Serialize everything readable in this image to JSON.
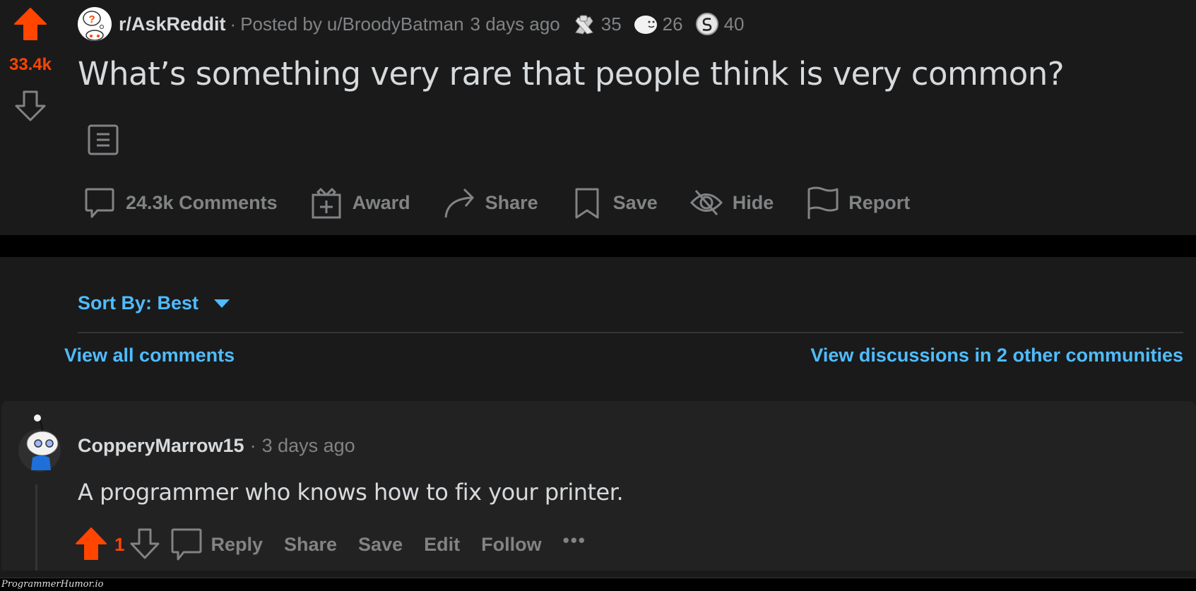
{
  "post": {
    "vote_score": "33.4k",
    "subreddit": "r/AskReddit",
    "separator": "·",
    "posted_by_label": "Posted by",
    "author": "u/BroodyBatman",
    "time": "3 days ago",
    "awards": [
      {
        "icon": "handshake-award-icon",
        "count": "35"
      },
      {
        "icon": "seal-award-icon",
        "count": "26"
      },
      {
        "icon": "coin-award-icon",
        "count": "40"
      }
    ],
    "title": "What’s something very rare that people think is very common?",
    "post_type_icon": "text-post-icon",
    "actions": {
      "comments": "24.3k Comments",
      "award": "Award",
      "share": "Share",
      "save": "Save",
      "hide": "Hide",
      "report": "Report"
    }
  },
  "comments_section": {
    "sort_label": "Sort By: Best",
    "view_all": "View all comments",
    "view_discussions": "View discussions in 2 other communities"
  },
  "comment": {
    "username": "CopperyMarrow15",
    "separator": "·",
    "time": "3 days ago",
    "body": "A programmer who knows how to fix your printer.",
    "score": "1",
    "actions": {
      "reply": "Reply",
      "share": "Share",
      "save": "Save",
      "edit": "Edit",
      "follow": "Follow",
      "more": "•••"
    }
  },
  "watermark": "ProgrammerHumor.io",
  "colors": {
    "upvote": "#ff4500",
    "link": "#4fbcff",
    "muted": "#818384",
    "text": "#d7dadc",
    "background": "#1a1a1b"
  }
}
